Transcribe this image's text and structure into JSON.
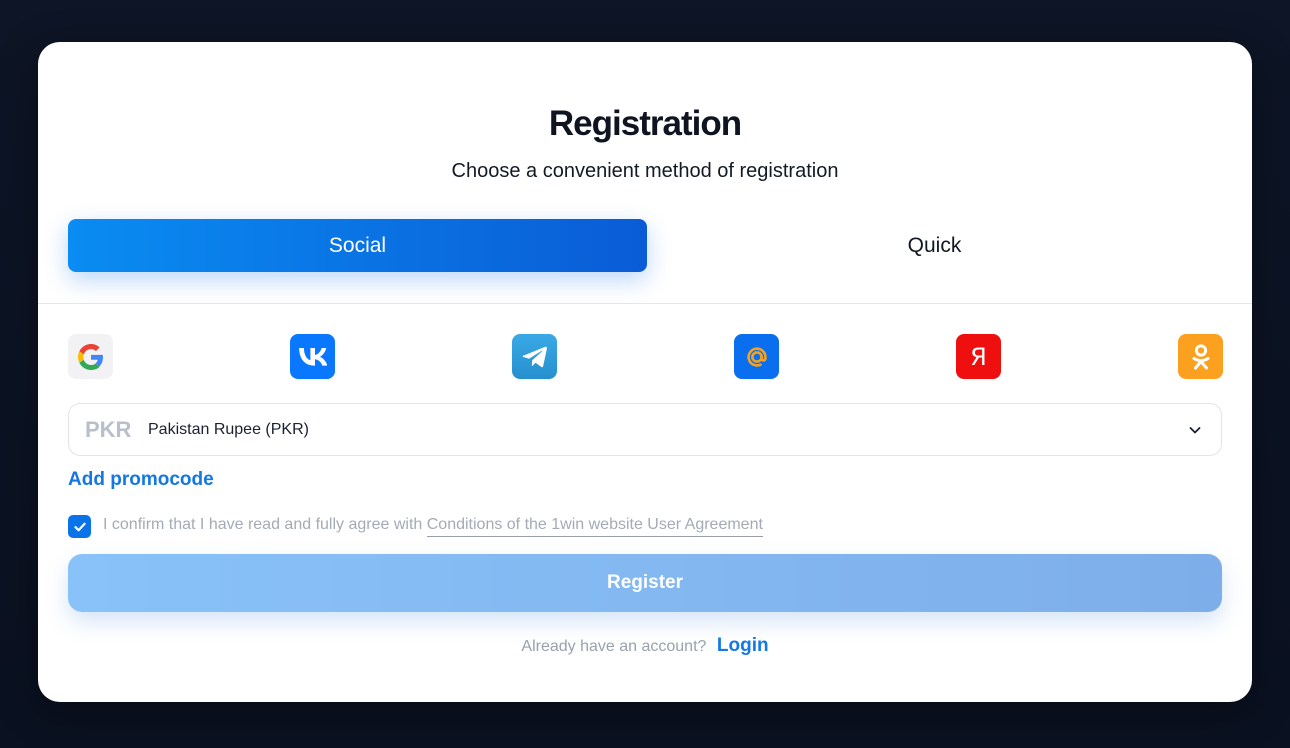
{
  "header": {
    "title": "Registration",
    "subtitle": "Choose a convenient method of registration"
  },
  "tabs": [
    {
      "label": "Social",
      "active": true
    },
    {
      "label": "Quick",
      "active": false
    }
  ],
  "social_methods": [
    {
      "icon": "google-icon"
    },
    {
      "icon": "vk-icon"
    },
    {
      "icon": "telegram-icon"
    },
    {
      "icon": "mail-ru-icon"
    },
    {
      "icon": "yandex-icon",
      "glyph": "Я"
    },
    {
      "icon": "odnoklassniki-icon"
    }
  ],
  "currency": {
    "code": "PKR",
    "name": "Pakistan Rupee (PKR)"
  },
  "promo": {
    "label": "Add promocode"
  },
  "agreement": {
    "checked": true,
    "text": "I confirm that I have read and fully agree with",
    "link_text": "Conditions of the 1win website User Agreement"
  },
  "register": {
    "label": "Register"
  },
  "login": {
    "prompt": "Already have an account?",
    "link": "Login"
  },
  "colors": {
    "primary": "#0a73e8",
    "backdrop": "#0b1222"
  }
}
